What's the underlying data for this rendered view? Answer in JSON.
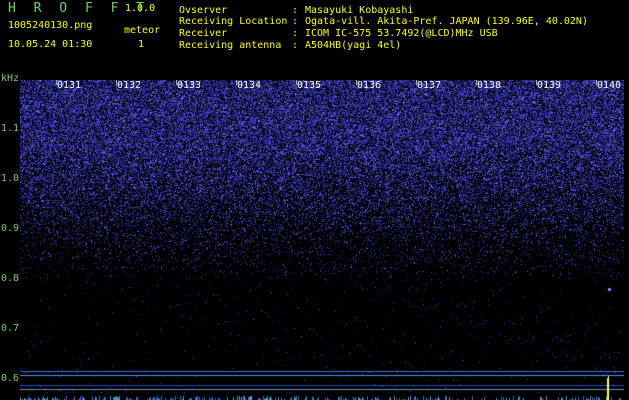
{
  "header": {
    "title": "H R O F F T",
    "version": "1.0.0",
    "filename": "1005240130.png",
    "meteor_label": "meteor",
    "datetime": "10.05.24 01:30",
    "meteor_count": "1"
  },
  "info": [
    {
      "label": "Ovserver",
      "value": "Masayuki Kobayashi"
    },
    {
      "label": "Receiving Location",
      "value": "Ogata-vill. Akita-Pref. JAPAN (139.96E, 40.02N)"
    },
    {
      "label": "Receiver",
      "value": "ICOM IC-575 53.7492(@LCD)MHz USB"
    },
    {
      "label": "Receiving antenna",
      "value": "A504HB(yagi 4el)"
    }
  ],
  "axis": {
    "unit": "kHz",
    "freq_ticks": [
      "1.1",
      "1.0",
      "0.9",
      "0.8",
      "0.7",
      "0.6"
    ],
    "minute_labels": [
      "0131",
      "0132",
      "0133",
      "0134",
      "0135",
      "0136",
      "0137",
      "0138",
      "0139",
      "0140"
    ]
  },
  "colors": {
    "axis_green": "#6fd06f",
    "noise_blue": "#3a48ff",
    "meteor_yellow": "#ffff00",
    "carrier_line": "#5a8cff"
  }
}
